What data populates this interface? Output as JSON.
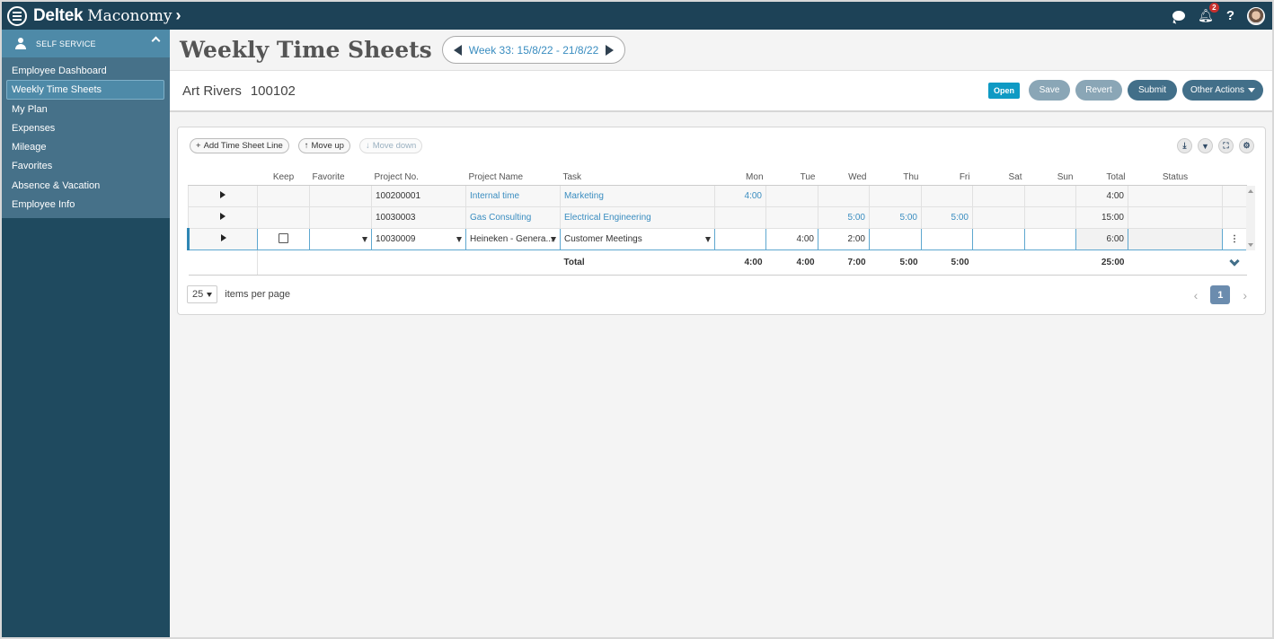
{
  "app": {
    "brand_deltek": "Deltek",
    "brand_maconomy": "Maconomy",
    "brand_chevron": "›",
    "notification_count": "2",
    "help_label": "?"
  },
  "sidebar": {
    "section_label": "SELF SERVICE",
    "items": [
      {
        "label": "Employee Dashboard",
        "active": false
      },
      {
        "label": "Weekly Time Sheets",
        "active": true
      },
      {
        "label": "My Plan",
        "active": false
      },
      {
        "label": "Expenses",
        "active": false
      },
      {
        "label": "Mileage",
        "active": false
      },
      {
        "label": "Favorites",
        "active": false
      },
      {
        "label": "Absence & Vacation",
        "active": false
      },
      {
        "label": "Employee Info",
        "active": false
      }
    ]
  },
  "header": {
    "title": "Weekly Time Sheets",
    "week_label": "Week 33: 15/8/22 - 21/8/22"
  },
  "employee": {
    "name": "Art Rivers",
    "id": "100102"
  },
  "actions": {
    "status": "Open",
    "save": "Save",
    "revert": "Revert",
    "submit": "Submit",
    "other": "Other Actions"
  },
  "toolbar": {
    "add_line": "Add Time Sheet Line",
    "move_up": "Move up",
    "move_down": "Move down"
  },
  "grid": {
    "columns": [
      "",
      "Keep",
      "Favorite",
      "Project No.",
      "Project Name",
      "Task",
      "Mon",
      "Tue",
      "Wed",
      "Thu",
      "Fri",
      "Sat",
      "Sun",
      "Total",
      "Status"
    ],
    "rows": [
      {
        "project_no": "100200001",
        "project_name": "Internal time",
        "task": "Marketing",
        "mon": "4:00",
        "tue": "",
        "wed": "",
        "thu": "",
        "fri": "",
        "sat": "",
        "sun": "",
        "total": "4:00",
        "status": ""
      },
      {
        "project_no": "10030003",
        "project_name": "Gas Consulting",
        "task": "Electrical Engineering",
        "mon": "",
        "tue": "",
        "wed": "5:00",
        "thu": "5:00",
        "fri": "5:00",
        "sat": "",
        "sun": "",
        "total": "15:00",
        "status": ""
      },
      {
        "project_no": "10030009",
        "project_name": "Heineken - Genera...",
        "task": "Customer Meetings",
        "mon": "",
        "tue": "4:00",
        "wed": "2:00",
        "thu": "",
        "fri": "",
        "sat": "",
        "sun": "",
        "total": "6:00",
        "status": "",
        "keep": false,
        "favorite": ""
      }
    ],
    "totals": {
      "label": "Total",
      "mon": "4:00",
      "tue": "4:00",
      "wed": "7:00",
      "thu": "5:00",
      "fri": "5:00",
      "sat": "",
      "sun": "",
      "total": "25:00"
    }
  },
  "pager": {
    "page_size": "25",
    "items_per_page": "items per page",
    "current_page": "1",
    "prev": "‹",
    "next": "›"
  },
  "colors": {
    "topbar": "#1d4257",
    "sidebar": "#1f4a5f",
    "sidebar_menu": "#467189",
    "accent_link": "#3a8dc0",
    "status_open": "#0f9ac4",
    "primary_button": "#426f89"
  }
}
